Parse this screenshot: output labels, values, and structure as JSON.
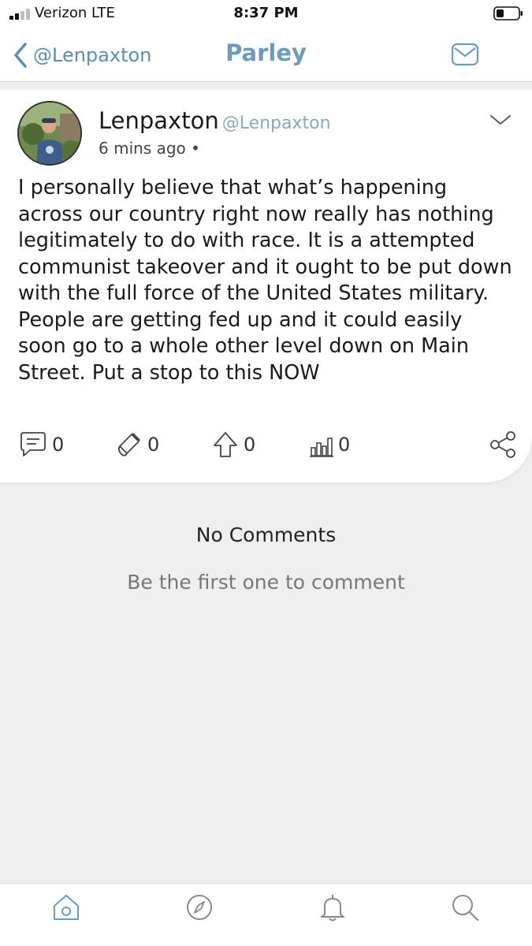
{
  "status_bar": {
    "carrier": "Verizon  LTE",
    "time": "8:37 PM"
  },
  "nav": {
    "back_label": "@Lenpaxton",
    "title": "Parley",
    "accent_color": "#6b9bbf",
    "icons": [
      "chevron-left-icon",
      "mail-icon"
    ]
  },
  "post": {
    "author_name": "Lenpaxton",
    "author_handle": "@Lenpaxton",
    "time_ago": "6 mins ago •",
    "body": "I personally believe that what’s happening across our country right now really has nothing legitimately to do with race. It is a attempted communist takeover and it ought to be put down with the full force of the United States military. People are getting fed up and it could easily soon go to a whole other level down on Main Street. Put a stop to this NOW",
    "counts": {
      "comments": "0",
      "echoes": "0",
      "upvotes": "0",
      "impressions": "0"
    }
  },
  "comments": {
    "empty_title": "No Comments",
    "empty_subtitle": "Be the first one to comment"
  },
  "tabbar": {
    "icons": [
      "home-icon",
      "compass-icon",
      "bell-icon",
      "search-icon"
    ]
  }
}
